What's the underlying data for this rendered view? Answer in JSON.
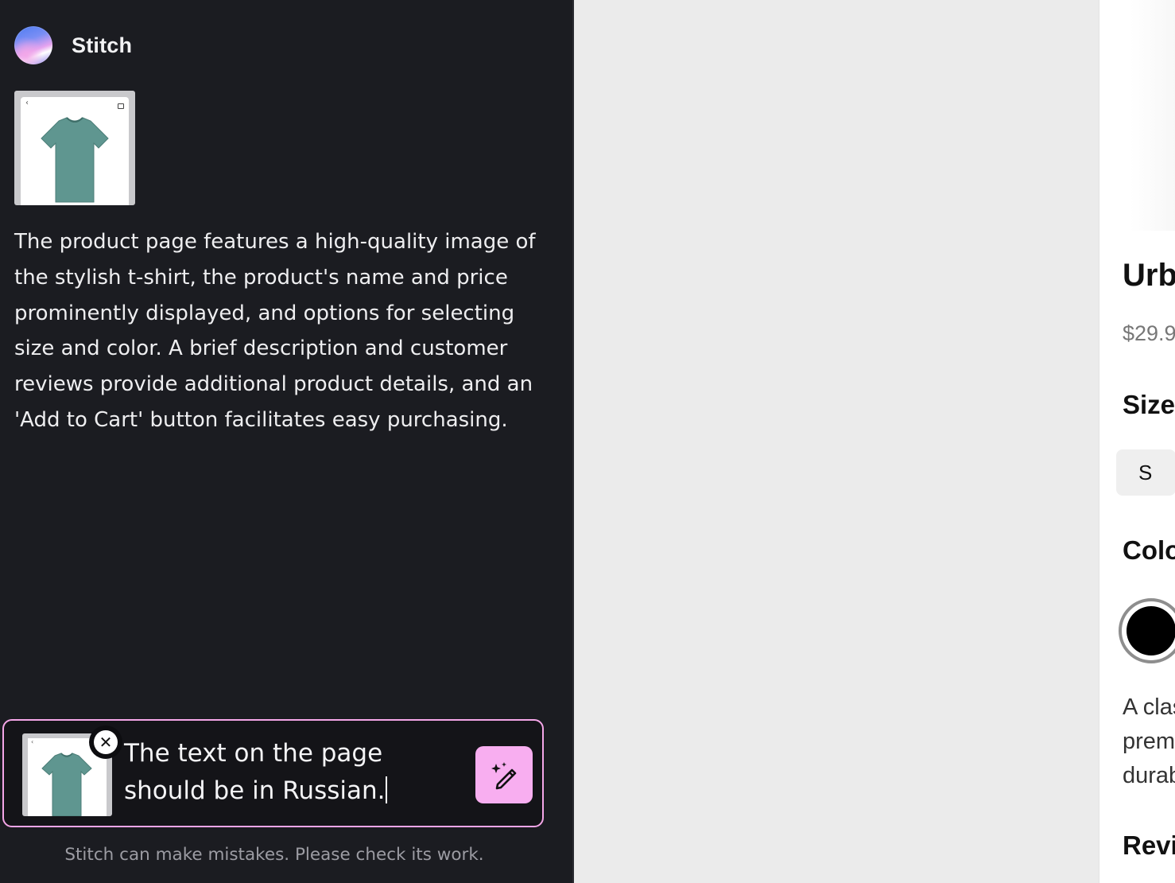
{
  "app": {
    "title": "Stitch"
  },
  "chat": {
    "response": "The product page features a high-quality image of the stylish t-shirt, the product's name and price prominently displayed, and options for selecting size and color. A brief description and customer reviews provide additional product details, and an 'Add to Cart' button facilitates easy purchasing.",
    "thumbnail_icon": "tshirt-icon"
  },
  "composer": {
    "prompt_value": "The text on the page should be in Russian.",
    "attachment_icon": "tshirt-icon",
    "remove_icon": "close-icon",
    "send_icon": "magic-pen-icon",
    "border_color": "#f5a6e8",
    "send_color": "#f8aef0"
  },
  "footer": {
    "disclaimer": "Stitch can make mistakes. Please check its work."
  },
  "preview": {
    "title_fragment": "Urb",
    "price_fragment": "$29.9",
    "size_heading": "Size",
    "size_option": "S",
    "color_heading": "Colo",
    "selected_color": "#000000",
    "description_lines": [
      "A clas",
      "prem",
      "durab"
    ],
    "reviews_heading": "Revie"
  }
}
